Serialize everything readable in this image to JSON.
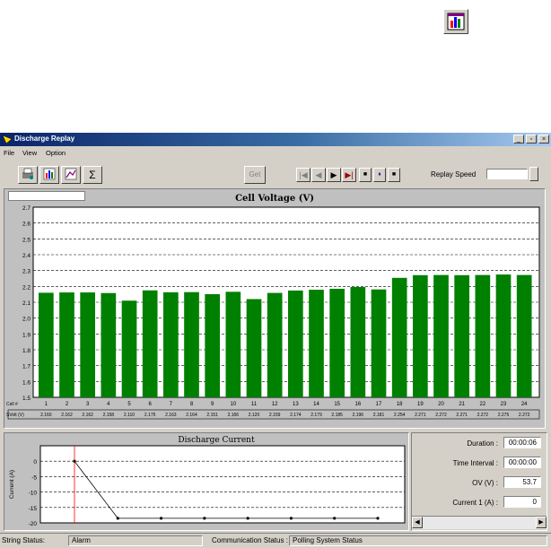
{
  "app": {
    "title": "Discharge Replay"
  },
  "menu": {
    "file": "File",
    "view": "View",
    "option": "Option"
  },
  "toolbar": {
    "get_label": "Get",
    "sigma_label": "Σ",
    "replay_speed_label": "Replay Speed"
  },
  "chart_data": [
    {
      "type": "bar",
      "title": "Cell Voltage  (V)",
      "ylim": [
        1.5,
        2.7
      ],
      "yticks": [
        "2.7",
        "2.6",
        "2.5",
        "2.4",
        "2.3",
        "2.2",
        "2.1",
        "2.0",
        "1.9",
        "1.8",
        "1.7",
        "1.6",
        "1.5"
      ],
      "row_labels": [
        "Cell #",
        "SVolt (V)"
      ],
      "categories": [
        "1",
        "2",
        "3",
        "4",
        "5",
        "6",
        "7",
        "8",
        "9",
        "10",
        "11",
        "12",
        "13",
        "14",
        "15",
        "16",
        "17",
        "18",
        "19",
        "20",
        "21",
        "22",
        "23",
        "24"
      ],
      "values": [
        2.16,
        2.162,
        2.162,
        2.158,
        2.11,
        2.175,
        2.163,
        2.164,
        2.151,
        2.166,
        2.12,
        2.159,
        2.174,
        2.179,
        2.185,
        2.196,
        2.181,
        2.254,
        2.271,
        2.272,
        2.271,
        2.272,
        2.275,
        2.272
      ],
      "value_labels": [
        "2.160",
        "2.162",
        "2.162",
        "2.158",
        "2.110",
        "2.175",
        "2.163",
        "2.164",
        "2.151",
        "2.166",
        "2.120",
        "2.159",
        "2.174",
        "2.179",
        "2.185",
        "2.196",
        "2.181",
        "2.254",
        "2.271",
        "2.272",
        "2.271",
        "2.272",
        "2.275",
        "2.272"
      ],
      "bar_color": "#008000",
      "grid": true
    },
    {
      "type": "line",
      "title": "Discharge Current",
      "ylabel": "Current (A)",
      "ylim": [
        -20,
        5
      ],
      "yticks": [
        "0",
        "-5",
        "-10",
        "-15",
        "-20"
      ],
      "x": [
        0,
        1,
        2,
        3,
        4,
        5,
        6,
        7
      ],
      "values": [
        0,
        -18.5,
        -18.5,
        -18.5,
        -18.5,
        -18.5,
        -18.5,
        -18.5
      ],
      "line_color": "#000000",
      "marker_color": "#ff0000"
    }
  ],
  "info": {
    "duration_label": "Duration :",
    "duration_value": "00:00:06",
    "interval_label": "Time Interval :",
    "interval_value": "00:00:00",
    "ov_label": "OV (V) :",
    "ov_value": "53.7",
    "current_label": "Current 1 (A) :",
    "current_value": "0"
  },
  "status": {
    "string_label": "String Status:",
    "string_value": "Alarm",
    "comm_label": "Communication Status :",
    "comm_value": "Polling System Status"
  },
  "colors": {
    "titlebar": "#0a246a",
    "bar": "#008000",
    "marker_line": "#ff0000"
  },
  "icons": [
    "app-chart-icon",
    "print-icon",
    "battery-chart-icon",
    "chart-icon",
    "sigma-icon",
    "first-icon",
    "prev-icon",
    "play-icon",
    "last-icon",
    "step-back-icon",
    "pause-icon",
    "stop-icon"
  ]
}
